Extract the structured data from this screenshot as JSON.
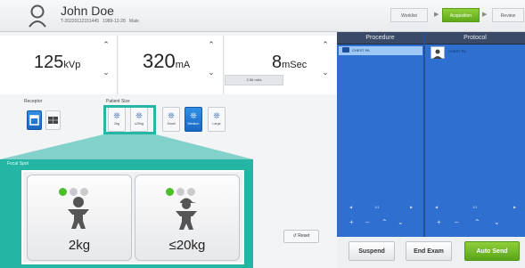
{
  "header": {
    "patient_name": "John Doe",
    "patient_meta": "T-20220112151445   1989-12-28   Male",
    "steps": [
      "Worklist",
      "Acquisition",
      "Review"
    ],
    "active_step": "Acquisition"
  },
  "exposure": {
    "kvp_value": "125",
    "kvp_unit": "kVp",
    "ma_value": "320",
    "ma_unit": "mA",
    "msec_value": "8",
    "msec_unit": "mSec",
    "mas": "2.56 mAs"
  },
  "receptor": {
    "label": "Receptor"
  },
  "patient_size": {
    "label": "Patient Size",
    "options": [
      "2kg",
      "≤20kg",
      "Small",
      "Medium",
      "Large"
    ],
    "selected": "Medium"
  },
  "focal_spot": {
    "label": "Focal Spot"
  },
  "zoom": {
    "options": [
      "2kg",
      "≤20kg"
    ]
  },
  "reset": {
    "label": "Reset"
  },
  "procedure": {
    "header": "Procedure",
    "items": [
      "CHEST PA"
    ],
    "pager": "1/1"
  },
  "protocol": {
    "header": "Protocol",
    "items": [
      "CHEST PA"
    ],
    "pager": "1/1"
  },
  "actions": {
    "suspend": "Suspend",
    "end_exam": "End Exam",
    "auto_send": "Auto Send"
  },
  "colors": {
    "highlight": "#25b6a6",
    "accent_blue": "#2f6fd0",
    "accent_green": "#6cbd24",
    "dot_on": "#4bbf2a",
    "dot_off": "#c8cacd"
  },
  "icons": [
    "person-icon",
    "folder-icon",
    "receptor-wall-icon",
    "receptor-table-icon",
    "reset-icon",
    "chevron-up-icon",
    "chevron-down-icon"
  ]
}
